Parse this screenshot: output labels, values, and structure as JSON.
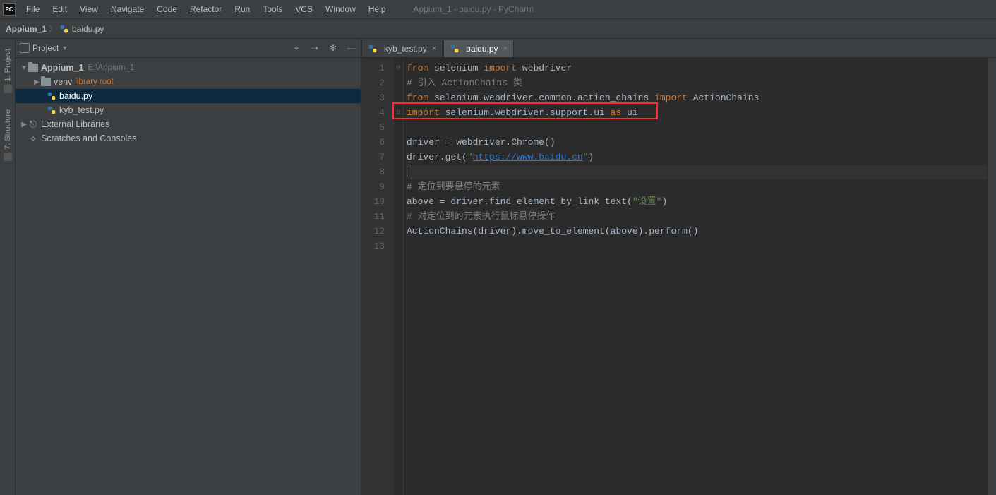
{
  "title": "Appium_1 - baidu.py - PyCharm",
  "menu": [
    "File",
    "Edit",
    "View",
    "Navigate",
    "Code",
    "Refactor",
    "Run",
    "Tools",
    "VCS",
    "Window",
    "Help"
  ],
  "breadcrumb": {
    "project": "Appium_1",
    "file": "baidu.py"
  },
  "left_tabs": {
    "project": "1: Project",
    "structure": "7: Structure"
  },
  "project_panel": {
    "title": "Project",
    "tools": {
      "locate": "⌖",
      "collapse": "⇢",
      "settings": "✻",
      "hide": "—"
    },
    "tree": {
      "root": {
        "name": "Appium_1",
        "path": "E:\\Appium_1"
      },
      "venv": {
        "name": "venv",
        "tag": "library root"
      },
      "files": [
        "baidu.py",
        "kyb_test.py"
      ],
      "external": "External Libraries",
      "scratches": "Scratches and Consoles"
    }
  },
  "editor_tabs": [
    {
      "name": "kyb_test.py",
      "active": false
    },
    {
      "name": "baidu.py",
      "active": true
    }
  ],
  "code": {
    "lines": [
      {
        "n": 1,
        "tokens": [
          {
            "t": "from ",
            "c": "kw"
          },
          {
            "t": "selenium "
          },
          {
            "t": "import ",
            "c": "kw"
          },
          {
            "t": "webdriver"
          }
        ]
      },
      {
        "n": 2,
        "tokens": [
          {
            "t": "# 引入 ActionChains 类",
            "c": "cmt"
          }
        ]
      },
      {
        "n": 3,
        "tokens": [
          {
            "t": "from ",
            "c": "kw"
          },
          {
            "t": "selenium.webdriver.common.action_chains "
          },
          {
            "t": "import ",
            "c": "kw"
          },
          {
            "t": "ActionChains"
          }
        ]
      },
      {
        "n": 4,
        "tokens": [
          {
            "t": "import ",
            "c": "kw"
          },
          {
            "t": "selenium.webdriver.support.ui "
          },
          {
            "t": "as ",
            "c": "kw"
          },
          {
            "t": "ui"
          }
        ],
        "boxed": true
      },
      {
        "n": 5,
        "tokens": []
      },
      {
        "n": 6,
        "tokens": [
          {
            "t": "driver = webdriver.Chrome()"
          }
        ]
      },
      {
        "n": 7,
        "tokens": [
          {
            "t": "driver.get("
          },
          {
            "t": "\"",
            "c": "str"
          },
          {
            "t": "https://www.baidu.cn",
            "c": "url"
          },
          {
            "t": "\"",
            "c": "str"
          },
          {
            "t": ")"
          }
        ]
      },
      {
        "n": 8,
        "tokens": [],
        "current": true,
        "caret": true
      },
      {
        "n": 9,
        "tokens": [
          {
            "t": "# 定位到要悬停的元素",
            "c": "cmt"
          }
        ]
      },
      {
        "n": 10,
        "tokens": [
          {
            "t": "above = driver.find_element_by_link_text("
          },
          {
            "t": "\"设置\"",
            "c": "str"
          },
          {
            "t": ")"
          }
        ]
      },
      {
        "n": 11,
        "tokens": [
          {
            "t": "# 对定位到的元素执行鼠标悬停操作",
            "c": "cmt"
          }
        ]
      },
      {
        "n": 12,
        "tokens": [
          {
            "t": "ActionChains(driver).move_to_element(above).perform()"
          }
        ]
      },
      {
        "n": 13,
        "tokens": []
      }
    ]
  }
}
